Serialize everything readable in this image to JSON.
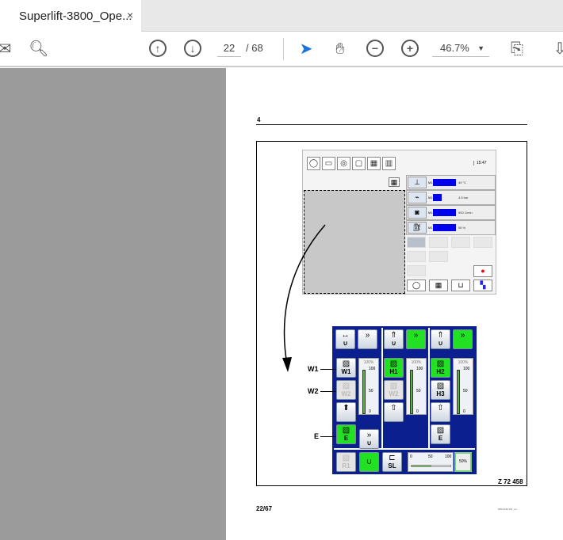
{
  "tab": {
    "title": "Superlift-3800_Ope...",
    "close": "×"
  },
  "toolbar": {
    "page_current": "22",
    "page_total": "/ 68",
    "zoom": "46.7%",
    "icons": [
      "mail-icon",
      "search-icon",
      "page-up-icon",
      "page-down-icon",
      "select-pointer-icon",
      "hand-icon",
      "zoom-out-icon",
      "zoom-in-icon",
      "fit-page-icon",
      "download-icon"
    ]
  },
  "page": {
    "header_number": "4",
    "figure_id": "Z 72 458",
    "footer_left": "22/67",
    "footer_right": "008-1040-101_en",
    "screen": {
      "time": "15:47",
      "rows": [
        {
          "m": "M1",
          "value": "49 °C",
          "fill": 0.55
        },
        {
          "m": "M1",
          "value": "4.5 bar",
          "fill": 0.2
        },
        {
          "m": "M1",
          "value": "900 1/min",
          "fill": 0.55
        },
        {
          "m": "M1",
          "value": "55 %",
          "fill": 0.55
        }
      ]
    },
    "panel": {
      "callouts": [
        "W1",
        "W2",
        "E"
      ],
      "col1": {
        "w1": "W1",
        "w2": "W2",
        "e": "E",
        "pct": "100%",
        "ticks": [
          "100",
          "50",
          "0"
        ]
      },
      "col2": {
        "h1": "H1",
        "w2": "W2",
        "pct": "100%",
        "ticks": [
          "100",
          "50",
          "0"
        ]
      },
      "col3": {
        "h2": "H2",
        "h3": "H3",
        "e": "E",
        "pct": "100%",
        "ticks": [
          "100",
          "50",
          "0"
        ]
      },
      "bottom": {
        "r1": "R1",
        "sl": "SL",
        "scale": [
          "0",
          "50",
          "100"
        ],
        "value": "50%",
        "fill": 0.5
      }
    }
  }
}
